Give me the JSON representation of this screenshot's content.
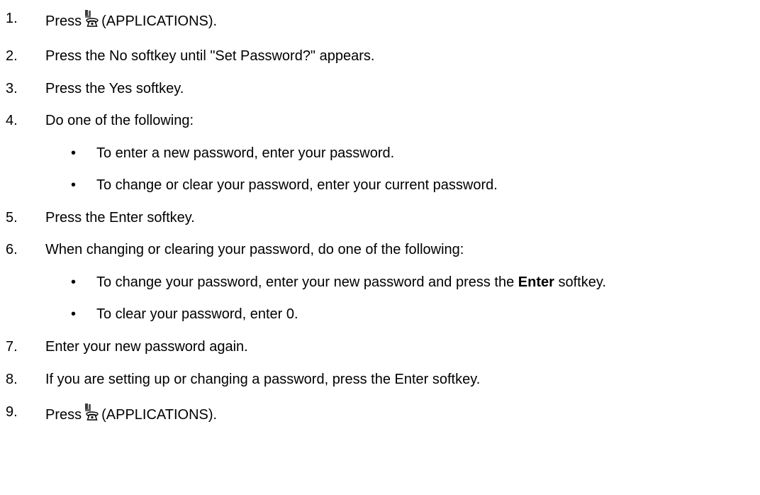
{
  "steps": [
    {
      "num": "1.",
      "before": "Press",
      "after": "(APPLICATIONS)."
    },
    {
      "num": "2.",
      "text": "Press the No softkey until \"Set Password?\" appears."
    },
    {
      "num": "3.",
      "text": "Press the Yes softkey."
    },
    {
      "num": "4.",
      "text": "Do one of the following:"
    },
    {
      "num": "5.",
      "text": "Press the Enter softkey."
    },
    {
      "num": "6.",
      "text": "When changing or clearing your password, do one of the following:"
    },
    {
      "num": "7.",
      "text": "Enter your new password again."
    },
    {
      "num": "8.",
      "text": "If you are setting up or changing a password, press the Enter softkey."
    },
    {
      "num": "9.",
      "before": "Press",
      "after": "(APPLICATIONS)."
    }
  ],
  "bullets_step4": [
    "To enter a new password, enter your password.",
    "To change or clear your password, enter your current password."
  ],
  "bullets_step6": [
    {
      "before": "To change your password, enter your new password and press the",
      "bold": "Enter",
      "after": "softkey."
    },
    {
      "text": "To clear your password, enter 0."
    }
  ],
  "bullet_char": "•",
  "icon_name": "applications-icon"
}
